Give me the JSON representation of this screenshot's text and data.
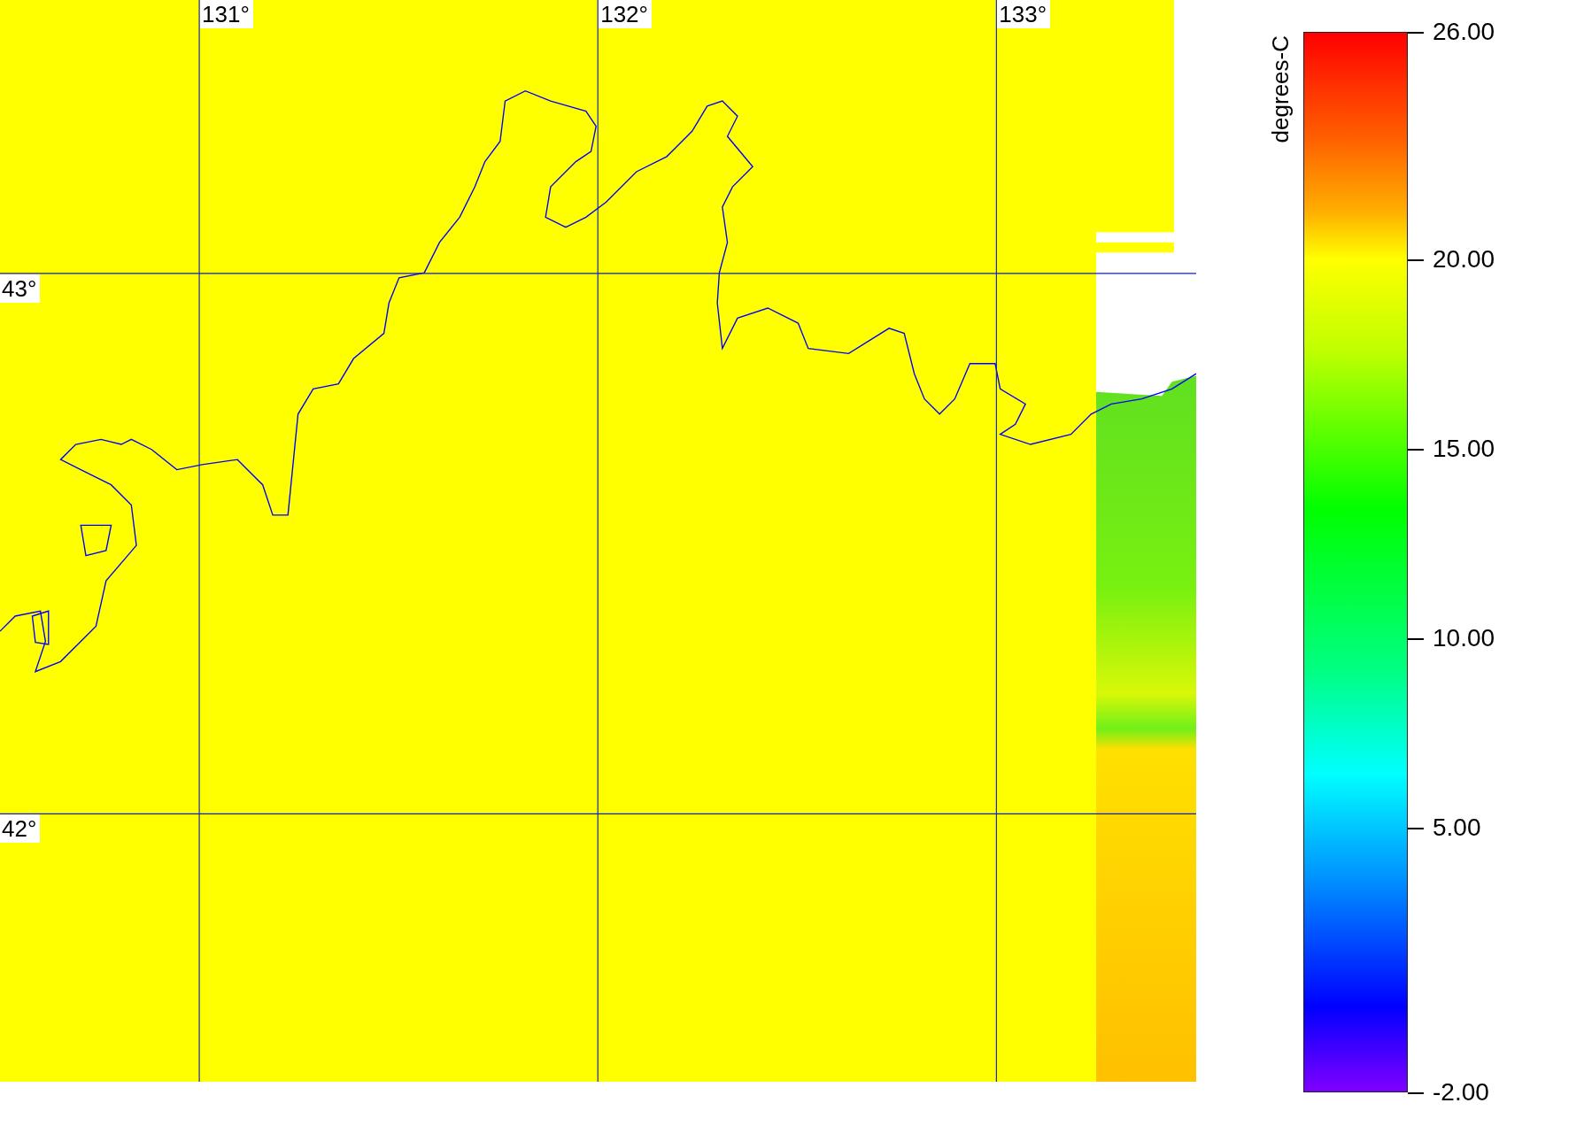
{
  "map": {
    "longitude_labels": [
      "131°",
      "132°",
      "133°"
    ],
    "latitude_labels": [
      "43°",
      "42°"
    ]
  },
  "colorbar": {
    "unit": "degrees-C",
    "ticks": [
      "26.00",
      "20.00",
      "15.00",
      "10.00",
      "5.00",
      "-2.00"
    ]
  }
}
